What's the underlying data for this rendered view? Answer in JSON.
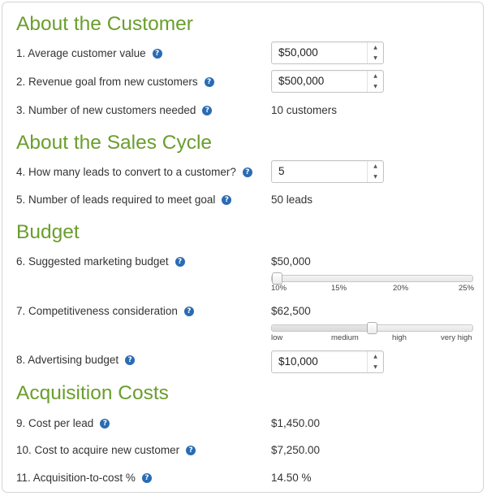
{
  "sections": {
    "customer": "About the Customer",
    "sales_cycle": "About the Sales Cycle",
    "budget": "Budget",
    "acquisition": "Acquisition Costs"
  },
  "rows": {
    "avg_customer_value": {
      "label": "1. Average customer value",
      "value": "$50,000"
    },
    "revenue_goal": {
      "label": "2. Revenue goal from new customers",
      "value": "$500,000"
    },
    "customers_needed": {
      "label": "3. Number of new customers needed",
      "value": "10 customers"
    },
    "leads_per_customer": {
      "label": "4. How many leads to convert to a customer?",
      "value": "5"
    },
    "leads_required": {
      "label": "5. Number of leads required to meet goal",
      "value": "50 leads"
    },
    "marketing_budget": {
      "label": "6. Suggested marketing budget",
      "value": "$50,000"
    },
    "competitiveness": {
      "label": "7. Competitiveness consideration",
      "value": "$62,500"
    },
    "advertising_budget": {
      "label": "8. Advertising budget",
      "value": "$10,000"
    },
    "cost_per_lead": {
      "label": "9. Cost per lead",
      "value": "$1,450.00"
    },
    "cost_to_acquire": {
      "label": "10. Cost to acquire new customer",
      "value": "$7,250.00"
    },
    "acq_to_cost": {
      "label": "11. Acquisition-to-cost %",
      "value": "14.50 %"
    }
  },
  "budget_slider": {
    "ticks": [
      "10%",
      "15%",
      "20%",
      "25%"
    ],
    "level": 0.0
  },
  "competitiveness_slider": {
    "ticks": [
      "low",
      "medium",
      "high",
      "very high"
    ],
    "level": 0.5
  },
  "help_glyph": "?",
  "stepper_up": "▲",
  "stepper_down": "▼",
  "colors": {
    "heading": "#6a9e2d",
    "help_icon": "#2a6bb3"
  }
}
